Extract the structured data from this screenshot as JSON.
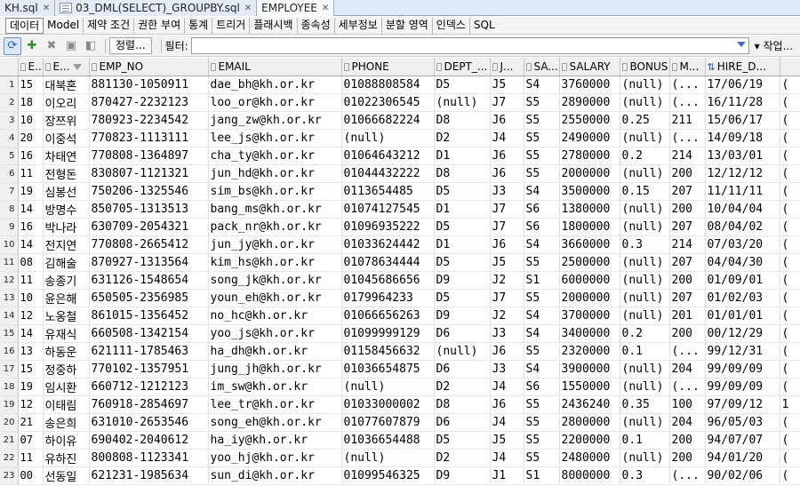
{
  "tabs": [
    {
      "label": "KH.sql",
      "icon": "none",
      "active": false
    },
    {
      "label": "03_DML(SELECT)_GROUPBY.sql",
      "icon": "sql-file-icon",
      "active": false
    },
    {
      "label": "EMPLOYEE",
      "icon": "table-icon",
      "active": true
    }
  ],
  "subtabs": [
    "데이터",
    "Model",
    "제약 조건",
    "권한 부여",
    "통계",
    "트리거",
    "플래시백",
    "종속성",
    "세부정보",
    "분할 영역",
    "인덱스",
    "SQL"
  ],
  "toolbar": {
    "sort_label": "정렬...",
    "filter_label": "필터:",
    "filter_value": "",
    "action_label": "▾ 작업..."
  },
  "columns": [
    "E...",
    "E...",
    "EMP_NO",
    "EMAIL",
    "PHONE",
    "DEPT_...",
    "J...",
    "SA...",
    "SALARY",
    "BONUS",
    "M...",
    "HIRE_D..."
  ],
  "rows": [
    [
      "1",
      "15",
      "대북혼",
      "881130-1050911",
      "dae_bh@kh.or.kr",
      "01088808584",
      "D5",
      "J5",
      "S4",
      "3760000",
      "(null)",
      "(...",
      "17/06/19",
      "("
    ],
    [
      "2",
      "18",
      "이오리",
      "870427-2232123",
      "loo_or@kh.or.kr",
      "01022306545",
      "(null)",
      "J7",
      "S5",
      "2890000",
      "(null)",
      "(...",
      "16/11/28",
      "("
    ],
    [
      "3",
      "10",
      "장쯔위",
      "780923-2234542",
      "jang_zw@kh.or.kr",
      "01066682224",
      "D8",
      "J6",
      "S5",
      "2550000",
      "0.25",
      "211",
      "15/06/17",
      "("
    ],
    [
      "4",
      "20",
      "이중석",
      "770823-1113111",
      "lee_js@kh.or.kr",
      "(null)",
      "D2",
      "J4",
      "S5",
      "2490000",
      "(null)",
      "(...",
      "14/09/18",
      "("
    ],
    [
      "5",
      "16",
      "차태연",
      "770808-1364897",
      "cha_ty@kh.or.kr",
      "01064643212",
      "D1",
      "J6",
      "S5",
      "2780000",
      "0.2",
      "214",
      "13/03/01",
      "("
    ],
    [
      "6",
      "11",
      "전형돈",
      "830807-1121321",
      "jun_hd@kh.or.kr",
      "01044432222",
      "D8",
      "J6",
      "S5",
      "2000000",
      "(null)",
      "200",
      "12/12/12",
      "("
    ],
    [
      "7",
      "19",
      "심봉선",
      "750206-1325546",
      "sim_bs@kh.or.kr",
      "0113654485",
      "D5",
      "J3",
      "S4",
      "3500000",
      "0.15",
      "207",
      "11/11/11",
      "("
    ],
    [
      "8",
      "14",
      "방명수",
      "850705-1313513",
      "bang_ms@kh.or.kr",
      "01074127545",
      "D1",
      "J7",
      "S6",
      "1380000",
      "(null)",
      "200",
      "10/04/04",
      "("
    ],
    [
      "9",
      "16",
      "박나라",
      "630709-2054321",
      "pack_nr@kh.or.kr",
      "01096935222",
      "D5",
      "J7",
      "S6",
      "1800000",
      "(null)",
      "207",
      "08/04/02",
      "("
    ],
    [
      "10",
      "14",
      "전지연",
      "770808-2665412",
      "jun_jy@kh.or.kr",
      "01033624442",
      "D1",
      "J6",
      "S4",
      "3660000",
      "0.3",
      "214",
      "07/03/20",
      "("
    ],
    [
      "11",
      "08",
      "김해술",
      "870927-1313564",
      "kim_hs@kh.or.kr",
      "01078634444",
      "D5",
      "J5",
      "S5",
      "2500000",
      "(null)",
      "207",
      "04/04/30",
      "("
    ],
    [
      "12",
      "11",
      "송종기",
      "631126-1548654",
      "song_jk@kh.or.kr",
      "01045686656",
      "D9",
      "J2",
      "S1",
      "6000000",
      "(null)",
      "200",
      "01/09/01",
      "("
    ],
    [
      "13",
      "10",
      "윤은해",
      "650505-2356985",
      "youn_eh@kh.or.kr",
      "0179964233",
      "D5",
      "J7",
      "S5",
      "2000000",
      "(null)",
      "207",
      "01/02/03",
      "("
    ],
    [
      "14",
      "12",
      "노옹철",
      "861015-1356452",
      "no_hc@kh.or.kr",
      "01066656263",
      "D9",
      "J2",
      "S4",
      "3700000",
      "(null)",
      "201",
      "01/01/01",
      "("
    ],
    [
      "15",
      "14",
      "유재식",
      "660508-1342154",
      "yoo_js@kh.or.kr",
      "01099999129",
      "D6",
      "J3",
      "S4",
      "3400000",
      "0.2",
      "200",
      "00/12/29",
      "("
    ],
    [
      "16",
      "13",
      "하동운",
      "621111-1785463",
      "ha_dh@kh.or.kr",
      "01158456632",
      "(null)",
      "J6",
      "S5",
      "2320000",
      "0.1",
      "(...",
      "99/12/31",
      "("
    ],
    [
      "17",
      "15",
      "정중하",
      "770102-1357951",
      "jung_jh@kh.or.kr",
      "01036654875",
      "D6",
      "J3",
      "S4",
      "3900000",
      "(null)",
      "204",
      "99/09/09",
      "("
    ],
    [
      "18",
      "19",
      "임시환",
      "660712-1212123",
      "im_sw@kh.or.kr",
      "(null)",
      "D2",
      "J4",
      "S6",
      "1550000",
      "(null)",
      "(...",
      "99/09/09",
      "("
    ],
    [
      "19",
      "12",
      "이태림",
      "760918-2854697",
      "lee_tr@kh.or.kr",
      "01033000002",
      "D8",
      "J6",
      "S5",
      "2436240",
      "0.35",
      "100",
      "97/09/12",
      "1"
    ],
    [
      "20",
      "21",
      "송은희",
      "631010-2653546",
      "song_eh@kh.or.kr",
      "01077607879",
      "D6",
      "J4",
      "S5",
      "2800000",
      "(null)",
      "204",
      "96/05/03",
      "("
    ],
    [
      "21",
      "07",
      "하이유",
      "690402-2040612",
      "ha_iy@kh.or.kr",
      "01036654488",
      "D5",
      "J5",
      "S5",
      "2200000",
      "0.1",
      "200",
      "94/07/07",
      "("
    ],
    [
      "22",
      "11",
      "유하진",
      "800808-1123341",
      "yoo_hj@kh.or.kr",
      "(null)",
      "D2",
      "J4",
      "S5",
      "2480000",
      "(null)",
      "200",
      "94/01/20",
      "("
    ],
    [
      "23",
      "00",
      "선동일",
      "621231-1985634",
      "sun_di@kh.or.kr",
      "01099546325",
      "D9",
      "J1",
      "S1",
      "8000000",
      "0.3",
      "(...",
      "90/02/06",
      "("
    ]
  ]
}
